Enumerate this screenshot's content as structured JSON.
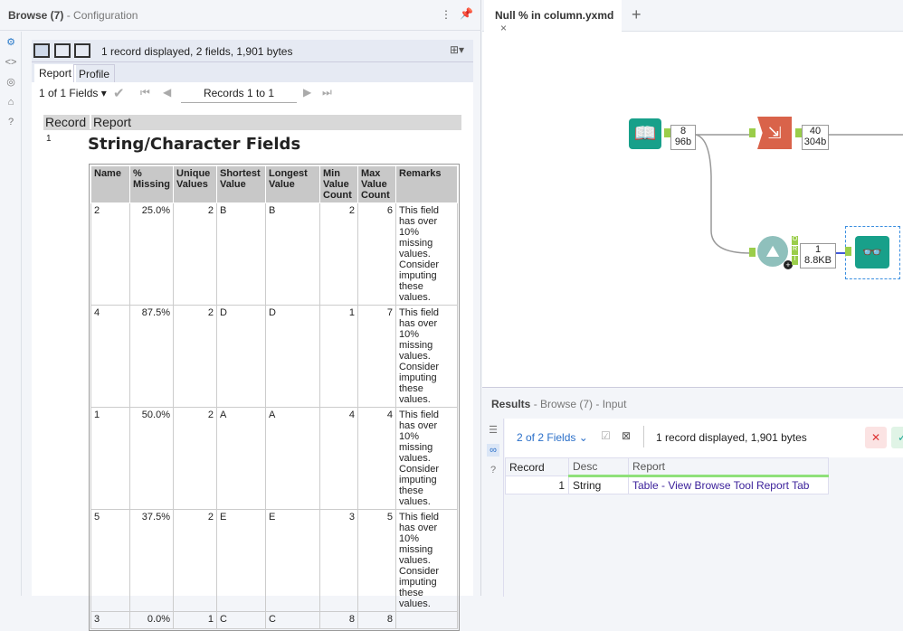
{
  "config_panel": {
    "title": "Browse (7)",
    "subtitle": "- Configuration",
    "toolbar_status": "1 record displayed, 2 fields, 1,901 bytes",
    "tabs": [
      "Report",
      "Profile"
    ],
    "fields_select": "1 of 1 Fields",
    "records_label": "Records 1 to 1",
    "report_headers": [
      "Record",
      "Report"
    ],
    "record_num": "1",
    "report_title": "String/Character Fields",
    "table": {
      "headers": [
        "Name",
        "% Missing",
        "Unique Values",
        "Shortest Value",
        "Longest Value",
        "Min Value Count",
        "Max Value Count",
        "Remarks"
      ],
      "rows": [
        [
          "2",
          "25.0%",
          "2",
          "B",
          "B",
          "2",
          "6",
          "This field has over 10% missing values. Consider imputing these values."
        ],
        [
          "4",
          "87.5%",
          "2",
          "D",
          "D",
          "1",
          "7",
          "This field has over 10% missing values. Consider imputing these values."
        ],
        [
          "1",
          "50.0%",
          "2",
          "A",
          "A",
          "4",
          "4",
          "This field has over 10% missing values. Consider imputing these values."
        ],
        [
          "5",
          "37.5%",
          "2",
          "E",
          "E",
          "3",
          "5",
          "This field has over 10% missing values. Consider imputing these values."
        ],
        [
          "3",
          "0.0%",
          "1",
          "C",
          "C",
          "8",
          "8",
          ""
        ]
      ]
    }
  },
  "workflow": {
    "tab_name": "Null % in column.yxmd",
    "tab_close": "×",
    "new_tab": "+",
    "input_count": {
      "records": "8",
      "size": "96b"
    },
    "transform_count": {
      "records": "40",
      "size": "304b"
    },
    "tool_count": {
      "records": "1",
      "size": "8.8KB"
    },
    "anchors": [
      "O",
      "R",
      "I"
    ]
  },
  "results": {
    "title": "Results",
    "subtitle": "- Browse (7) - Input",
    "fields_select": "2 of 2 Fields",
    "status": "1 record displayed, 1,901 bytes",
    "columns": [
      "Record",
      "Desc",
      "Report"
    ],
    "rows": [
      [
        "1",
        "String",
        "Table - View Browse Tool Report Tab"
      ]
    ]
  }
}
